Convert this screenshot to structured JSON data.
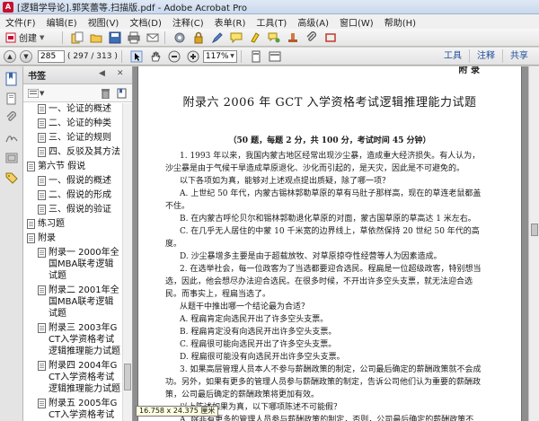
{
  "window": {
    "title": "[逻辑学导论].郭笑蕾等.扫描版.pdf - Adobe Acrobat Pro"
  },
  "menu": [
    "文件(F)",
    "编辑(E)",
    "视图(V)",
    "文档(D)",
    "注释(C)",
    "表单(R)",
    "工具(T)",
    "高级(A)",
    "窗口(W)",
    "帮助(H)"
  ],
  "toolbar": {
    "create_label": "创建"
  },
  "nav": {
    "page_value": "285",
    "page_count": "( 297 / 313 )",
    "zoom_value": "117%",
    "right_tools": [
      "工具",
      "注释",
      "共享"
    ]
  },
  "bookmarks": {
    "title": "书签",
    "items": [
      {
        "label": "一、论证的概述",
        "level": 2
      },
      {
        "label": "二、论证的种类",
        "level": 2
      },
      {
        "label": "三、论证的规则",
        "level": 2
      },
      {
        "label": "四、反驳及其方法",
        "level": 2
      },
      {
        "label": "第六节 假说",
        "level": 1
      },
      {
        "label": "一、假说的概述",
        "level": 2
      },
      {
        "label": "二、假说的形成",
        "level": 2
      },
      {
        "label": "三、假说的验证",
        "level": 2
      },
      {
        "label": "练习题",
        "level": 1
      },
      {
        "label": "附录",
        "level": 1
      },
      {
        "label": "附录一 2000年全国MBA联考逻辑试题",
        "level": 1
      },
      {
        "label": "附录二 2001年全国MBA联考逻辑试题",
        "level": 1
      },
      {
        "label": "附录三 2003年GCT入学资格考试逻辑推理能力试题",
        "level": 1
      },
      {
        "label": "附录四 2004年GCT入学资格考试逻辑推理能力试题",
        "level": 1
      },
      {
        "label": "附录五 2005年GCT入学资格考试逻辑推理能力试题",
        "level": 1
      }
    ]
  },
  "document": {
    "running_head": "附 录",
    "title": "附录六   2006 年 GCT 入学资格考试逻辑推理能力试题",
    "subtitle": "（50 题，每题 2 分，共 100 分，考试时间 45 分钟）",
    "paragraphs": [
      {
        "text": "1. 1993 年以来，我国内蒙古地区经常出现沙尘暴，造成重大经济损失。有人认为，沙尘暴是由于气候干旱造成草原退化、沙化而引起的，是天灾，因此是不可避免的。",
        "indent": true
      },
      {
        "text": "以下各项如为真，能够对上述观点提出质疑，除了哪一项？",
        "indent": true
      },
      {
        "text": "A. 上世纪 50 年代，内蒙古锡林郭勒草原的草有马肚子那样高，现在的草连老鼠都盖不住。",
        "indent": true
      },
      {
        "text": "B. 在内蒙古呼伦贝尔和锡林郭勒退化草原的对面，蒙古国草原的草高达 1 米左右。",
        "indent": true
      },
      {
        "text": "C. 在几乎无人居住的中蒙 10 千米宽的边界线上，草依然保持 20 世纪 50 年代的高度。",
        "indent": true
      },
      {
        "text": "D. 沙尘暴增多主要是由于超载放牧、对草原掠夺性经营等人为因素造成。",
        "indent": true
      },
      {
        "text": "2. 在选举社会，每一位政客为了当选都要迎合选民。程扁是一位超级政客，特别想当选，因此，他会想尽办法迎合选民。在很多时候，不开出许多空头支票，就无法迎合选民。而事实上，程扁当选了。",
        "indent": true
      },
      {
        "text": "从题干中推出哪一个结论最为合适？",
        "indent": true
      },
      {
        "text": "A. 程扁肯定向选民开出了许多空头支票。",
        "indent": true
      },
      {
        "text": "B. 程扁肯定没有向选民开出许多空头支票。",
        "indent": true
      },
      {
        "text": "C. 程扁很可能向选民开出了许多空头支票。",
        "indent": true
      },
      {
        "text": "D. 程扁很可能没有向选民开出许多空头支票。",
        "indent": true
      },
      {
        "text": "3. 如果高层管理人员本人不参与薪酬政策的制定，公司最后确定的薪酬政策就不会成功。另外，如果有更多的管理人员参与薪酬政策的制定，告诉公司他们认为重要的薪酬政策，公司最后确定的薪酬政策将更加有效。",
        "indent": true
      },
      {
        "text": "以上陈述如果为真，以下哪项陈述不可能假？",
        "indent": true
      },
      {
        "text": "A. 除非有更多的管理人员参与薪酬政策的制定，否则，公司最后确定的薪酬政策不会成功。",
        "indent": true
      }
    ]
  },
  "status_tip": "16.758 x 24.375 厘米"
}
